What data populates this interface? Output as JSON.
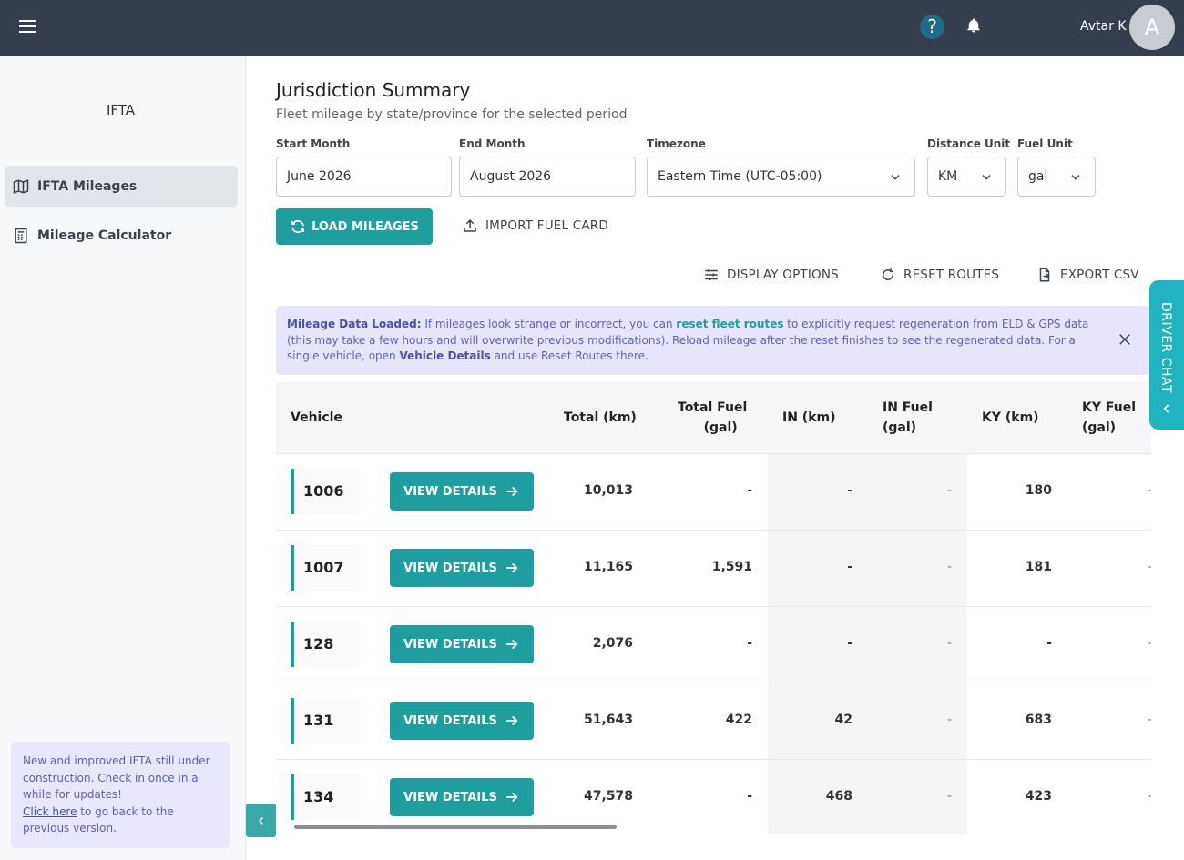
{
  "header": {
    "user_name": "Avtar K",
    "avatar_initial": "A",
    "help_label": "?"
  },
  "sidebar": {
    "title": "IFTA",
    "items": [
      {
        "label": "IFTA Mileages",
        "icon": "map-icon",
        "active": true
      },
      {
        "label": "Mileage Calculator",
        "icon": "calculator-icon",
        "active": false
      }
    ],
    "notice": {
      "text": "New and improved IFTA still under construction. Check in once in a while for updates!",
      "link_text": "Click here",
      "link_suffix": " to go back to the previous version."
    }
  },
  "main": {
    "title": "Jurisdiction Summary",
    "subtitle": "Fleet mileage by state/province for the selected period",
    "filters": {
      "start_month": {
        "label": "Start Month",
        "value": "June 2026"
      },
      "end_month": {
        "label": "End Month",
        "value": "August 2026"
      },
      "timezone": {
        "label": "Timezone",
        "value": "Eastern Time (UTC-05:00)"
      },
      "distance_unit": {
        "label": "Distance Unit",
        "value": "KM"
      },
      "fuel_unit": {
        "label": "Fuel Unit",
        "value": "gal"
      }
    },
    "actions": {
      "load": "LOAD MILEAGES",
      "import": "IMPORT FUEL CARD",
      "display": "DISPLAY OPTIONS",
      "reset": "RESET ROUTES",
      "export": "EXPORT CSV"
    },
    "alert": {
      "lead": "Mileage Data Loaded:",
      "part1": " If mileages look strange or incorrect, you can ",
      "link1": "reset fleet routes",
      "part2": " to explicitly request regeneration from ELD & GPS data (this may take a few hours and will overwrite previous modifications). Reload mileage after the reset finishes to see the regenerated data. For a single vehicle, open ",
      "link2": "Vehicle Details",
      "part3": " and use Reset Routes there."
    },
    "table": {
      "headers": {
        "vehicle": "Vehicle",
        "total": "Total (km)",
        "total_fuel_1": "Total Fuel",
        "total_fuel_2": "(gal)",
        "in": "IN (km)",
        "in_fuel_1": "IN Fuel",
        "in_fuel_2": "(gal)",
        "ky": "KY (km)",
        "ky_fuel_1": "KY Fuel",
        "ky_fuel_2": "(gal)"
      },
      "view_label": "VIEW DETAILS",
      "rows": [
        {
          "vehicle": "1006",
          "total": "10,013",
          "total_fuel": "-",
          "in": "-",
          "in_fuel": "-",
          "ky": "180",
          "ky_fuel": "-"
        },
        {
          "vehicle": "1007",
          "total": "11,165",
          "total_fuel": "1,591",
          "in": "-",
          "in_fuel": "-",
          "ky": "181",
          "ky_fuel": "-"
        },
        {
          "vehicle": "128",
          "total": "2,076",
          "total_fuel": "-",
          "in": "-",
          "in_fuel": "-",
          "ky": "-",
          "ky_fuel": "-"
        },
        {
          "vehicle": "131",
          "total": "51,643",
          "total_fuel": "422",
          "in": "42",
          "in_fuel": "-",
          "ky": "683",
          "ky_fuel": "-"
        },
        {
          "vehicle": "134",
          "total": "47,578",
          "total_fuel": "-",
          "in": "468",
          "in_fuel": "-",
          "ky": "423",
          "ky_fuel": "-"
        }
      ]
    }
  },
  "driver_chat": {
    "label": "DRIVER CHAT"
  },
  "colors": {
    "topbar": "#343e4c",
    "accent": "#1e9e9e",
    "alert_bg": "#e6e5fb"
  }
}
